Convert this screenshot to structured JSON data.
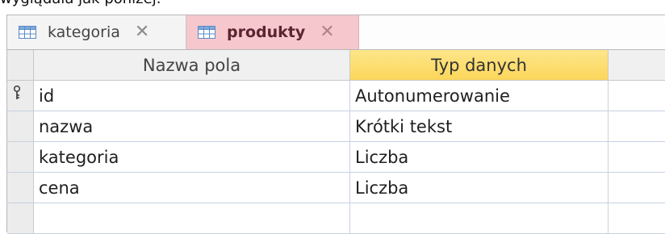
{
  "caption": "wyglądała jak poniżej.",
  "tabs": [
    {
      "label": "kategoria",
      "active": false,
      "icon": "table-icon"
    },
    {
      "label": "produkty",
      "active": true,
      "icon": "table-icon"
    }
  ],
  "grid": {
    "headers": {
      "field_name": "Nazwa pola",
      "data_type": "Typ danych"
    },
    "rows": [
      {
        "field_name": "id",
        "data_type": "Autonumerowanie",
        "primary_key": true
      },
      {
        "field_name": "nazwa",
        "data_type": "Krótki tekst",
        "primary_key": false
      },
      {
        "field_name": "kategoria",
        "data_type": "Liczba",
        "primary_key": false
      },
      {
        "field_name": "cena",
        "data_type": "Liczba",
        "primary_key": false
      },
      {
        "field_name": "",
        "data_type": "",
        "primary_key": false
      }
    ]
  },
  "colors": {
    "active_tab": "#f6c7cd",
    "selected_header": "#fbd65b",
    "grid_line": "#c6d2e1"
  }
}
